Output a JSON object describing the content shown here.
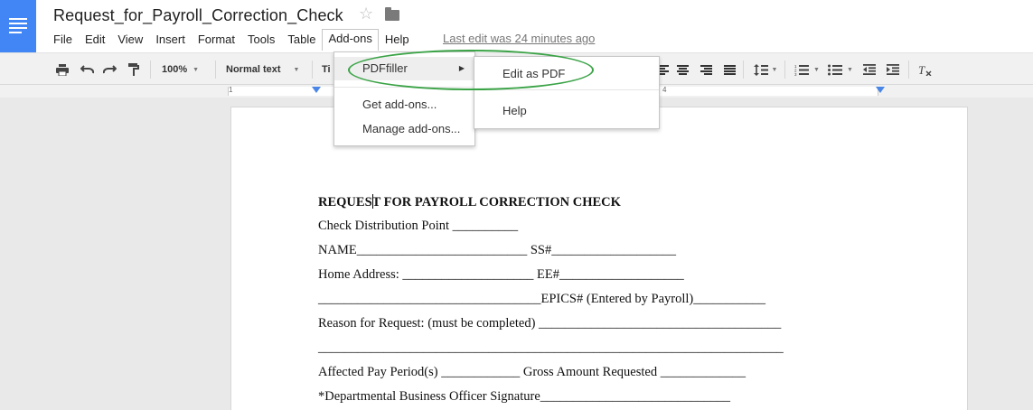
{
  "header": {
    "title": "Request_for_Payroll_Correction_Check",
    "last_edit": "Last edit was 24 minutes ago"
  },
  "menubar": [
    "File",
    "Edit",
    "View",
    "Insert",
    "Format",
    "Tools",
    "Table",
    "Add-ons",
    "Help"
  ],
  "toolbar": {
    "zoom": "100%",
    "style": "Normal text",
    "font_partial": "Ti",
    "icons": [
      "print-icon",
      "undo-icon",
      "redo-icon",
      "paint-format-icon",
      "align-center-icon",
      "align-right-icon",
      "justify-icon",
      "line-spacing-icon",
      "numbered-list-icon",
      "bulleted-list-icon",
      "decrease-indent-icon",
      "increase-indent-icon",
      "clear-formatting-icon"
    ]
  },
  "ruler": {
    "left_num": "1",
    "right_num": "4"
  },
  "addons_menu": {
    "items": [
      "PDFfiller",
      "Get add-ons...",
      "Manage add-ons..."
    ]
  },
  "pdffiller_submenu": {
    "items": [
      "Edit as PDF",
      "Help"
    ]
  },
  "document": {
    "heading_before_cursor": "REQUES",
    "heading_after_cursor": "T FOR PAYROLL CORRECTION CHECK",
    "lines": [
      "Check Distribution Point __________",
      "NAME__________________________ SS#___________________",
      "Home Address: ____________________ EE#___________________",
      "__________________________________EPICS# (Entered by Payroll)___________",
      "Reason for Request: (must be completed) _____________________________________",
      "_______________________________________________________________________",
      "Affected Pay Period(s) ____________ Gross Amount Requested _____________",
      "*Departmental Business Officer Signature_____________________________"
    ]
  },
  "colors": {
    "accent": "#4285f4",
    "annotation": "#3aa346"
  }
}
